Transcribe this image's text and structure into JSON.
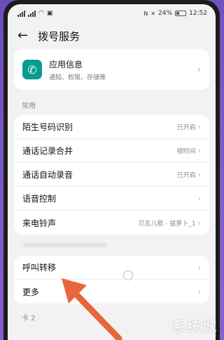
{
  "status": {
    "battery": "24%",
    "time": "12:52"
  },
  "header": {
    "title": "拨号服务"
  },
  "app_info": {
    "title": "应用信息",
    "subtitle": "通知、权限、存储等"
  },
  "sections": {
    "common_label": "常用",
    "sim2_label": "卡 2"
  },
  "common_rows": [
    {
      "label": "陌生号码识别",
      "value": "已开启"
    },
    {
      "label": "通话记录合并",
      "value": "按时间"
    },
    {
      "label": "通话自动录音",
      "value": "已开启"
    },
    {
      "label": "语音控制",
      "value": ""
    },
    {
      "label": "来电铃声",
      "value": "贝瓦儿歌 - 拔萝卜_1"
    }
  ],
  "sim_rows": [
    {
      "label": "呼叫转移"
    },
    {
      "label": "更多"
    }
  ],
  "watermark": "系统城",
  "colors": {
    "app_icon": "#0a9b8f",
    "arrow": "#e8663c",
    "background": "#f2f2f2"
  }
}
